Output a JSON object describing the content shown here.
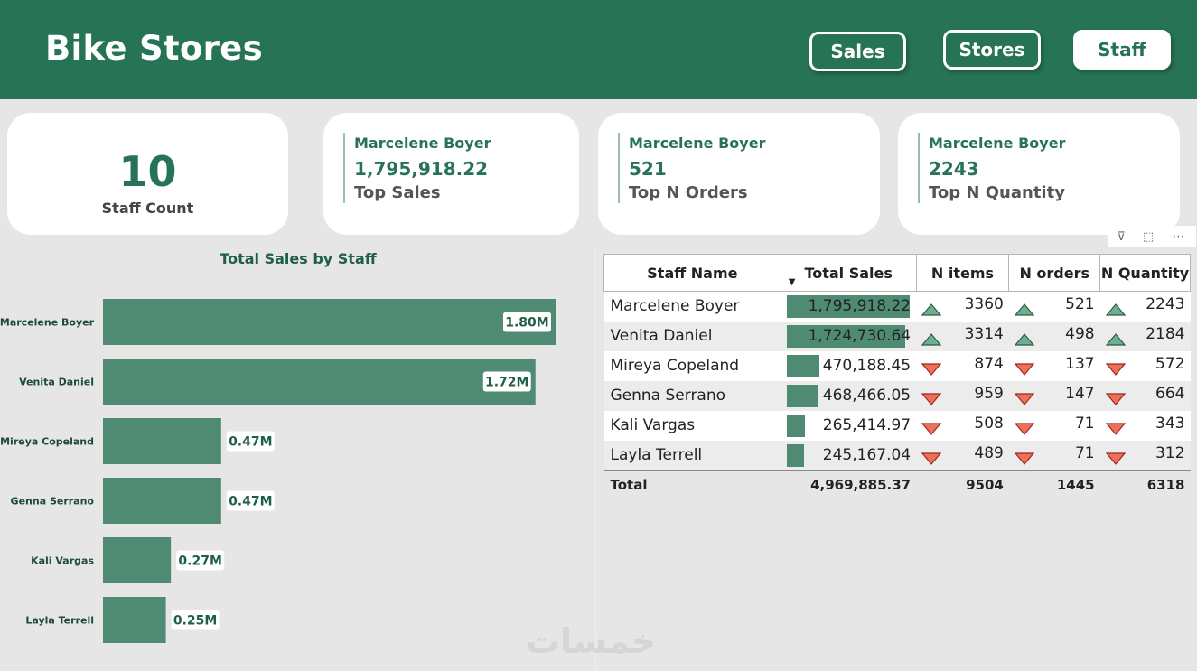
{
  "header": {
    "title": "Bike Stores",
    "nav": [
      {
        "label": "Sales",
        "active": false
      },
      {
        "label": "Stores",
        "active": false
      },
      {
        "label": "Staff",
        "active": true
      }
    ]
  },
  "cards": {
    "staff_count": {
      "value": "10",
      "label": "Staff Count"
    },
    "top_sales": {
      "name": "Marcelene Boyer",
      "value": "1,795,918.22",
      "label": "Top Sales"
    },
    "top_orders": {
      "name": "Marcelene Boyer",
      "value": "521",
      "label": "Top N Orders"
    },
    "top_quantity": {
      "name": "Marcelene Boyer",
      "value": "2243",
      "label": "Top N Quantity"
    }
  },
  "chart_data": {
    "type": "bar",
    "orientation": "horizontal",
    "title": "Total Sales by Staff",
    "categories": [
      "Marcelene Boyer",
      "Venita Daniel",
      "Mireya Copeland",
      "Genna Serrano",
      "Kali Vargas",
      "Layla Terrell"
    ],
    "values": [
      1.8,
      1.72,
      0.47,
      0.47,
      0.27,
      0.25
    ],
    "data_labels": [
      "1.80M",
      "1.72M",
      "0.47M",
      "0.47M",
      "0.27M",
      "0.25M"
    ],
    "xlim": [
      0,
      1.8
    ],
    "color": "#4e8b72"
  },
  "table": {
    "tools": {
      "filter": "⊽",
      "focus": "⬚",
      "more": "⋯"
    },
    "columns": [
      "Staff Name",
      "Total Sales",
      "N items",
      "N orders",
      "N Quantity"
    ],
    "rows": [
      {
        "name": "Marcelene Boyer",
        "sales": "1,795,918.22",
        "sales_value": 1795918.22,
        "items": "3360",
        "items_trend": "up",
        "orders": "521",
        "orders_trend": "up",
        "qty": "2243",
        "qty_trend": "up"
      },
      {
        "name": "Venita Daniel",
        "sales": "1,724,730.64",
        "sales_value": 1724730.64,
        "items": "3314",
        "items_trend": "up",
        "orders": "498",
        "orders_trend": "up",
        "qty": "2184",
        "qty_trend": "up"
      },
      {
        "name": "Mireya Copeland",
        "sales": "470,188.45",
        "sales_value": 470188.45,
        "items": "874",
        "items_trend": "down",
        "orders": "137",
        "orders_trend": "down",
        "qty": "572",
        "qty_trend": "down"
      },
      {
        "name": "Genna Serrano",
        "sales": "468,466.05",
        "sales_value": 468466.05,
        "items": "959",
        "items_trend": "down",
        "orders": "147",
        "orders_trend": "down",
        "qty": "664",
        "qty_trend": "down"
      },
      {
        "name": "Kali Vargas",
        "sales": "265,414.97",
        "sales_value": 265414.97,
        "items": "508",
        "items_trend": "down",
        "orders": "71",
        "orders_trend": "down",
        "qty": "343",
        "qty_trend": "down"
      },
      {
        "name": "Layla Terrell",
        "sales": "245,167.04",
        "sales_value": 245167.04,
        "items": "489",
        "items_trend": "down",
        "orders": "71",
        "orders_trend": "down",
        "qty": "312",
        "qty_trend": "down"
      }
    ],
    "total": {
      "label": "Total",
      "sales": "4,969,885.37",
      "items": "9504",
      "orders": "1445",
      "qty": "6318"
    },
    "colors": {
      "up": "#6fae8f",
      "down": "#f06f5a",
      "bar": "#4e8b72"
    }
  },
  "watermark": "خمسات"
}
